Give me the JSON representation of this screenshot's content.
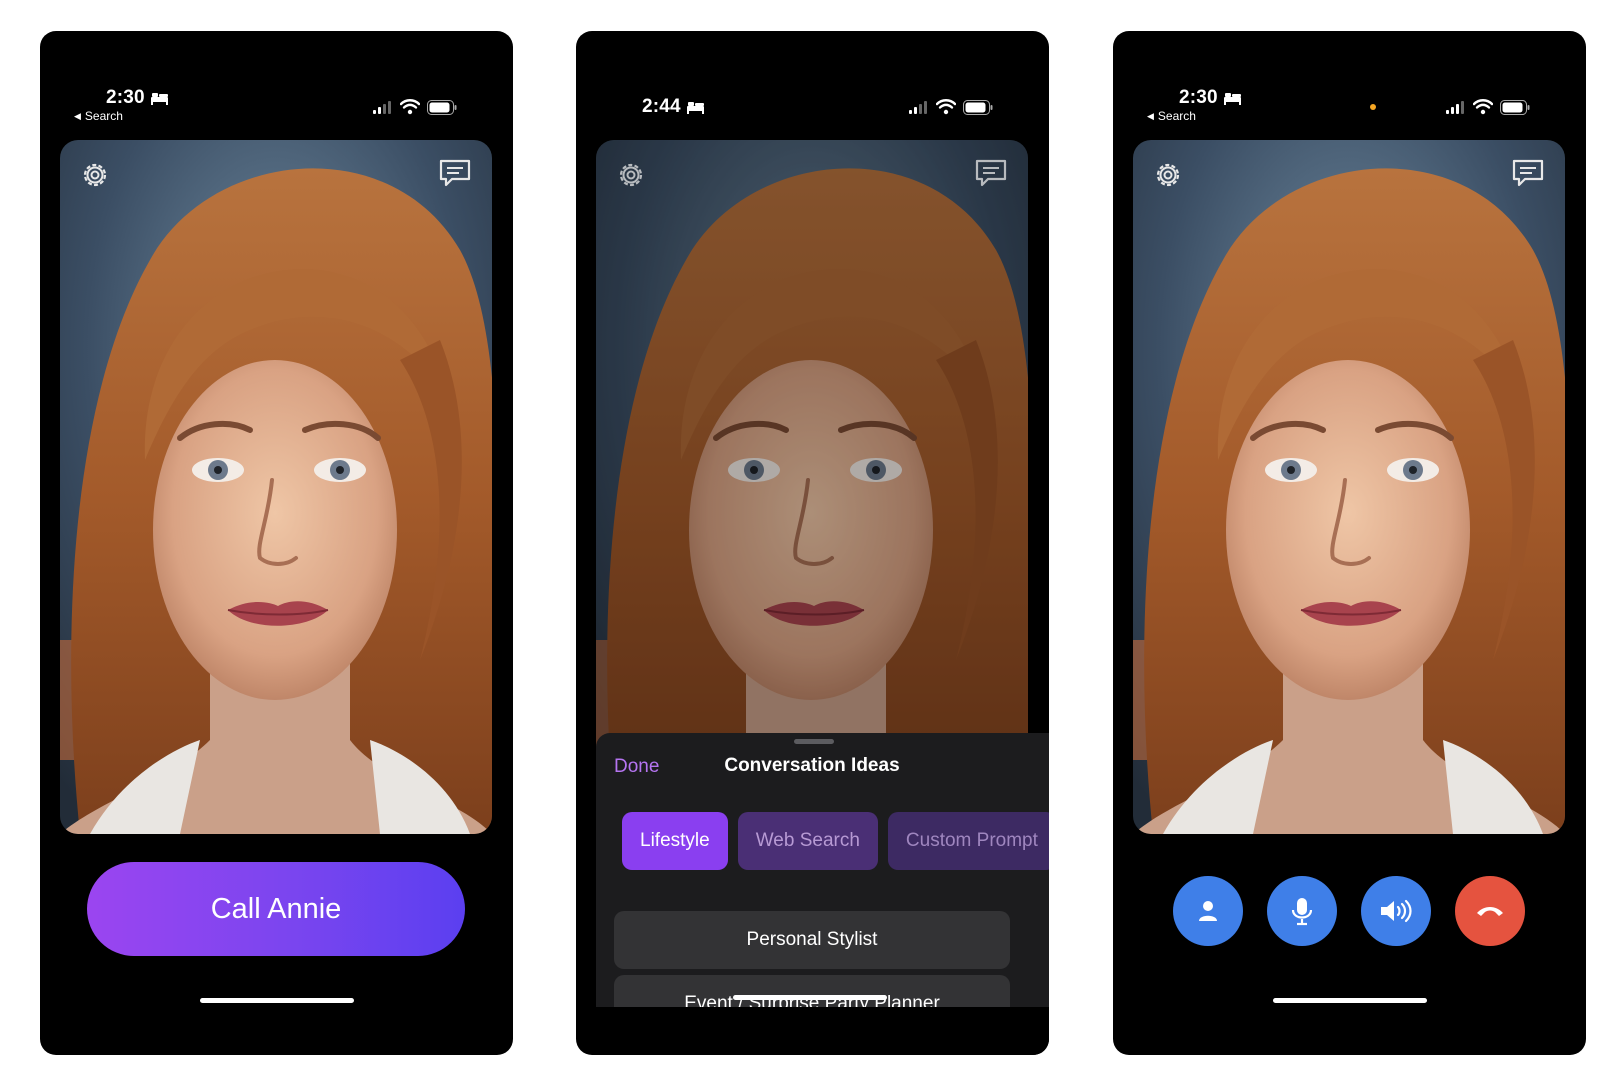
{
  "phones": [
    {
      "time": "2:30",
      "back_label": "Search",
      "call_button": "Call Annie"
    },
    {
      "time": "2:44",
      "sheet": {
        "done_label": "Done",
        "title": "Conversation Ideas",
        "tabs": [
          "Lifestyle",
          "Web Search",
          "Custom Prompt"
        ],
        "items": [
          "Personal Stylist",
          "Event / Surprise Party Planner"
        ]
      }
    },
    {
      "time": "2:30",
      "back_label": "Search",
      "controls": [
        "person-icon",
        "microphone-icon",
        "speaker-icon",
        "end-call-icon"
      ]
    }
  ],
  "colors": {
    "accent_purple": "#8a3ff0",
    "call_gradient_start": "#9b45f0",
    "call_gradient_end": "#5b3ff0",
    "control_blue": "#3f7fe8",
    "end_call_red": "#e5533f",
    "done_purple": "#b574f0"
  }
}
